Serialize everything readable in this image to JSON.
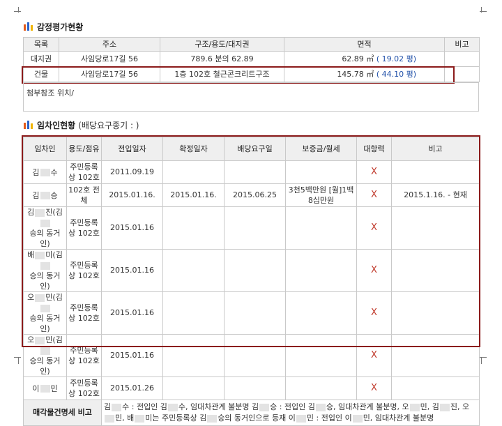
{
  "appraisal": {
    "title": "감정평가현황",
    "headers": [
      "목록",
      "주소",
      "구조/용도/대지권",
      "면적",
      "비고"
    ],
    "rows": [
      {
        "item": "대지권",
        "address": "사임당로17길 56",
        "structure": "789.6 분의 62.89",
        "area": "62.89 ㎡",
        "area_pyeong": "( 19.02 평)",
        "note": ""
      },
      {
        "item": "건물",
        "address": "사임당로17길 56",
        "structure": "1층 102호 철근콘크리트구조",
        "area": "145.78 ㎡",
        "area_pyeong": "( 44.10 평)",
        "note": ""
      }
    ],
    "attachment_note": "첨부참조 위치/"
  },
  "lease": {
    "title": "임차인현황",
    "subtitle": "(배당요구종기 : )",
    "headers": [
      "임차인",
      "용도/점유",
      "전입일자",
      "확정일자",
      "배당요구일",
      "보증금/월세",
      "대항력",
      "비고"
    ],
    "rows": [
      {
        "name_a": "김",
        "name_b": "수",
        "name_c": "",
        "usage": "주민등록상 102호",
        "move_in": "2011.09.19",
        "confirmed": "",
        "dividend": "",
        "deposit": "",
        "opposing": "X",
        "note": ""
      },
      {
        "name_a": "김",
        "name_b": "승",
        "name_c": "",
        "usage": "102호 전체",
        "move_in": "2015.01.16.",
        "confirmed": "2015.01.16.",
        "dividend": "2015.06.25",
        "deposit": "3천5백만원 [월]1백8십만원",
        "opposing": "X",
        "note": "2015.1.16. - 현재"
      },
      {
        "name_a": "김",
        "name_b": "진(김",
        "name_c": "승의 동거인)",
        "usage": "주민등록상 102호",
        "move_in": "2015.01.16",
        "confirmed": "",
        "dividend": "",
        "deposit": "",
        "opposing": "X",
        "note": ""
      },
      {
        "name_a": "배",
        "name_b": "미(김",
        "name_c": "승의 동거인)",
        "usage": "주민등록상 102호",
        "move_in": "2015.01.16",
        "confirmed": "",
        "dividend": "",
        "deposit": "",
        "opposing": "X",
        "note": ""
      },
      {
        "name_a": "오",
        "name_b": "민(김",
        "name_c": "승의 동거인)",
        "usage": "주민등록상 102호",
        "move_in": "2015.01.16",
        "confirmed": "",
        "dividend": "",
        "deposit": "",
        "opposing": "X",
        "note": ""
      },
      {
        "name_a": "오",
        "name_b": "민(김",
        "name_c": "승의 동거인)",
        "usage": "주민등록상 102호",
        "move_in": "2015.01.16",
        "confirmed": "",
        "dividend": "",
        "deposit": "",
        "opposing": "X",
        "note": ""
      },
      {
        "name_a": "이",
        "name_b": "민",
        "name_c": "",
        "usage": "주민등록상 102호",
        "move_in": "2015.01.26",
        "confirmed": "",
        "dividend": "",
        "deposit": "",
        "opposing": "X",
        "note": ""
      }
    ],
    "footer_label": "매각물건명세 비고",
    "footer_text": {
      "p1": "김",
      "p2": "수 : 전입인 김",
      "p3": "수, 임대차관계 불분명 김",
      "p4": "승 : 전입인 김",
      "p5": "승, 임대차관계 불분명, 오",
      "p6": "민, 김",
      "p7": "진, 오",
      "p8": "민, 배",
      "p9": "미는 주민등록상 김",
      "p10": "승의 동거인으로 등재 이",
      "p11": "민 : 전입인 이",
      "p12": "민, 임대차관계 불분명"
    }
  }
}
